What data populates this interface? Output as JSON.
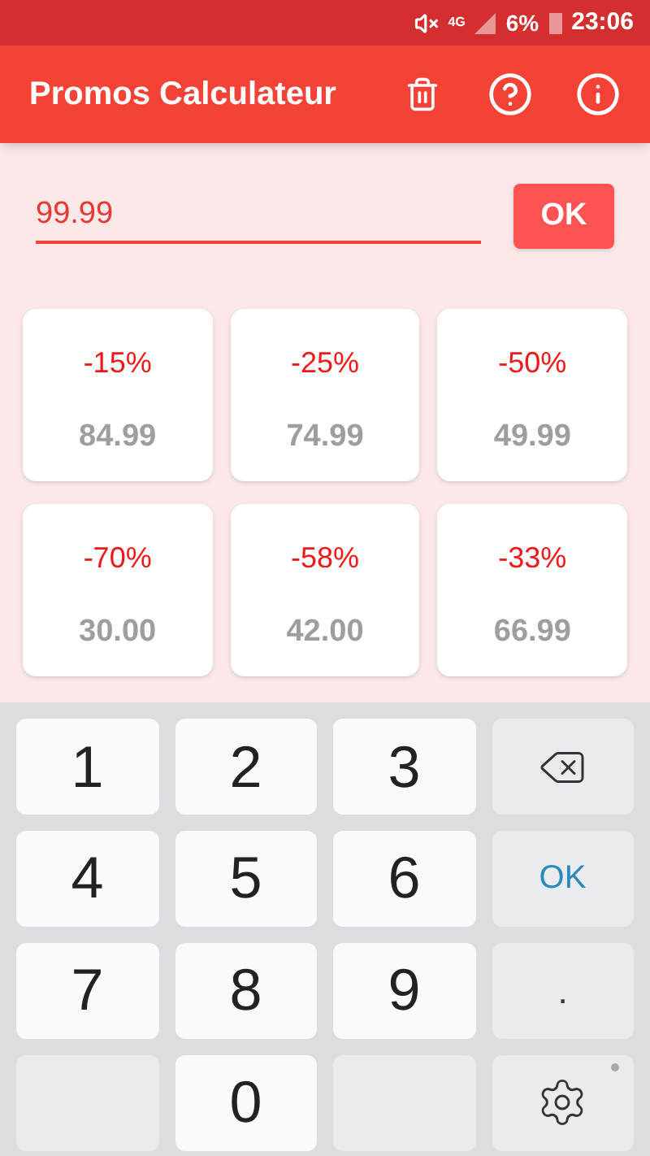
{
  "status_bar": {
    "network": "4G",
    "battery": "6%",
    "time": "23:06"
  },
  "app_bar": {
    "title": "Promos Calculateur"
  },
  "price_field": {
    "value": "99.99"
  },
  "ok_button": "OK",
  "discounts": [
    {
      "percent": "-15%",
      "price": "84.99"
    },
    {
      "percent": "-25%",
      "price": "74.99"
    },
    {
      "percent": "-50%",
      "price": "49.99"
    },
    {
      "percent": "-70%",
      "price": "30.00"
    },
    {
      "percent": "-58%",
      "price": "42.00"
    },
    {
      "percent": "-33%",
      "price": "66.99"
    }
  ],
  "keyboard": [
    {
      "kind": "digit",
      "label": "1"
    },
    {
      "kind": "digit",
      "label": "2"
    },
    {
      "kind": "digit",
      "label": "3"
    },
    {
      "kind": "backspace"
    },
    {
      "kind": "digit",
      "label": "4"
    },
    {
      "kind": "digit",
      "label": "5"
    },
    {
      "kind": "digit",
      "label": "6"
    },
    {
      "kind": "ok",
      "label": "OK"
    },
    {
      "kind": "digit",
      "label": "7"
    },
    {
      "kind": "digit",
      "label": "8"
    },
    {
      "kind": "digit",
      "label": "9"
    },
    {
      "kind": "dot",
      "label": "."
    },
    {
      "kind": "blank"
    },
    {
      "kind": "digit",
      "label": "0"
    },
    {
      "kind": "blank"
    },
    {
      "kind": "settings"
    }
  ]
}
